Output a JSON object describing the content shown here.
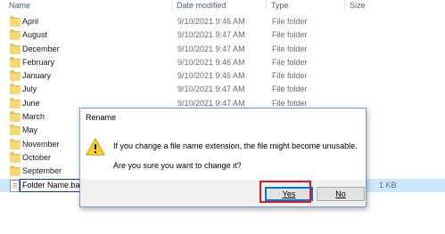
{
  "columns": {
    "name": "Name",
    "date_modified": "Date modified",
    "type": "Type",
    "size": "Size"
  },
  "rows": [
    {
      "name": "April",
      "date": "9/10/2021 9:46 AM",
      "type": "File folder",
      "size": "",
      "icon": "folder-icon"
    },
    {
      "name": "August",
      "date": "9/10/2021 9:47 AM",
      "type": "File folder",
      "size": "",
      "icon": "folder-icon"
    },
    {
      "name": "December",
      "date": "9/10/2021 9:47 AM",
      "type": "File folder",
      "size": "",
      "icon": "folder-icon"
    },
    {
      "name": "February",
      "date": "9/10/2021 9:46 AM",
      "type": "File folder",
      "size": "",
      "icon": "folder-icon"
    },
    {
      "name": "January",
      "date": "9/10/2021 9:46 AM",
      "type": "File folder",
      "size": "",
      "icon": "folder-icon"
    },
    {
      "name": "July",
      "date": "9/10/2021 9:47 AM",
      "type": "File folder",
      "size": "",
      "icon": "folder-icon"
    },
    {
      "name": "June",
      "date": "9/10/2021 9:47 AM",
      "type": "File folder",
      "size": "",
      "icon": "folder-icon"
    },
    {
      "name": "March",
      "date": "",
      "type": "",
      "size": "",
      "icon": "folder-icon"
    },
    {
      "name": "May",
      "date": "",
      "type": "",
      "size": "",
      "icon": "folder-icon"
    },
    {
      "name": "November",
      "date": "",
      "type": "",
      "size": "",
      "icon": "folder-icon"
    },
    {
      "name": "October",
      "date": "",
      "type": "",
      "size": "",
      "icon": "folder-icon"
    },
    {
      "name": "September",
      "date": "",
      "type": "",
      "size": "",
      "icon": "folder-icon"
    },
    {
      "name": "Folder Name.bat",
      "date": "",
      "type": "",
      "size": "1 KB",
      "icon": "file-icon",
      "renaming": true
    }
  ],
  "dialog": {
    "title": "Rename",
    "message_line1": "If you change a file name extension, the file might become unusable.",
    "message_line2": "Are you sure you want to change it?",
    "yes_label": "Yes",
    "no_label": "No",
    "icon": "warning-icon"
  },
  "colors": {
    "selection": "#cce8ff",
    "highlight_box": "#e01a1a",
    "default_button_border": "#0078d7"
  }
}
